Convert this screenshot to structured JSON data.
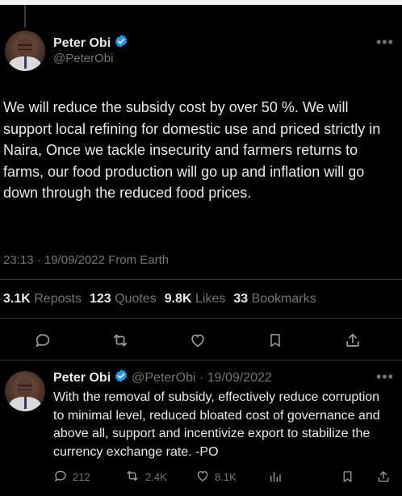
{
  "main_tweet": {
    "author_name": "Peter Obi",
    "handle": "@PeterObi",
    "text": "We will reduce the subsidy cost by over 50 %. We will support local refining for domestic use and priced strictly in Naira, Once we tackle insecurity and farmers returns to farms, our food production will go up and inflation will go down through the reduced food prices.",
    "timestamp": "23:13 · 19/09/2022 From Earth",
    "stats": {
      "reposts_count": "3.1K",
      "reposts_label": "Reposts",
      "quotes_count": "123",
      "quotes_label": "Quotes",
      "likes_count": "9.8K",
      "likes_label": "Likes",
      "bookmarks_count": "33",
      "bookmarks_label": "Bookmarks"
    },
    "actions": [
      "reply-icon",
      "repost-icon",
      "like-icon",
      "bookmark-icon",
      "share-icon"
    ]
  },
  "reply_tweet": {
    "author_name": "Peter Obi",
    "handle_date": "@PeterObi · 19/09/2022",
    "text": "With the removal of subsidy, effectively reduce corruption to minimal level, reduced bloated cost of governance and above all, support and incentivize export to stabilize the currency exchange rate. -PO",
    "replies": "212",
    "reposts": "2.4K",
    "likes": "8.1K",
    "actions": [
      "reply-icon",
      "repost-icon",
      "like-icon",
      "views-icon",
      "bookmark-icon",
      "share-icon"
    ]
  },
  "more_icon": "•••",
  "colors": {
    "background": "#000000",
    "text": "#e7e9ea",
    "muted": "#71767b",
    "verified": "#1d9bf0",
    "divider": "#2f3336"
  }
}
